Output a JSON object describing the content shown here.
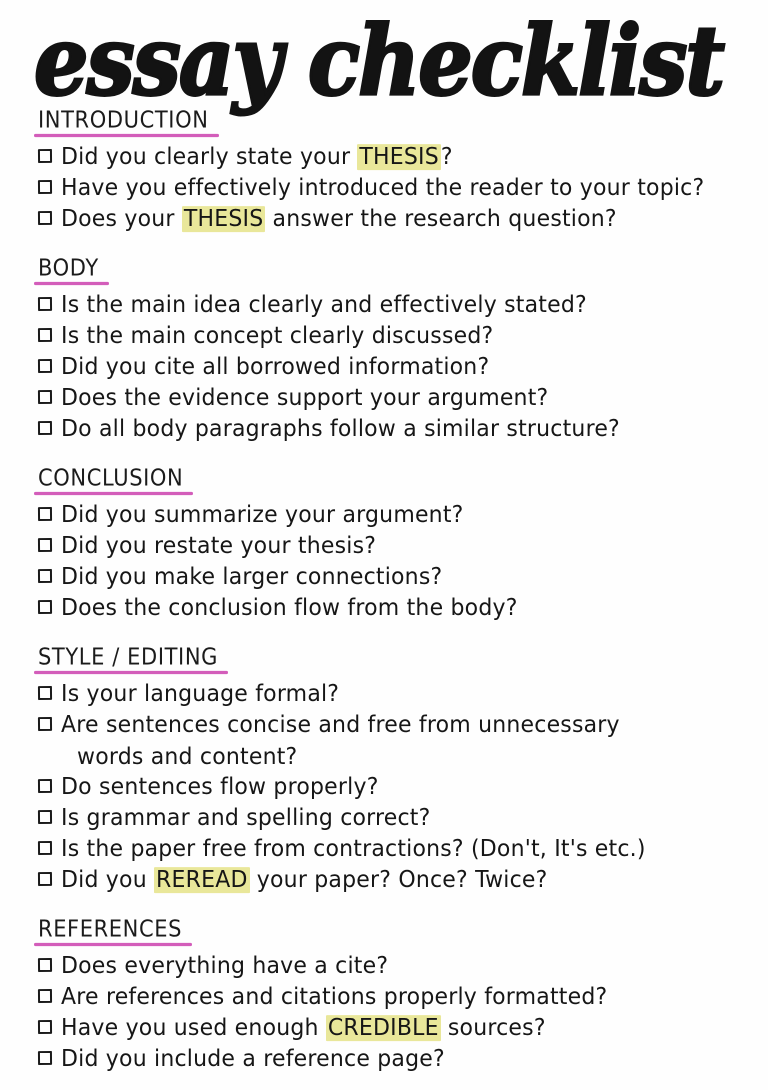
{
  "title": "essay checklist",
  "colors": {
    "ink": "#161616",
    "heading_underline": "#cf4fb4",
    "highlight": "#e9e79a",
    "page_background": "#fefefe"
  },
  "checkbox_glyph": "empty-square",
  "sections": [
    {
      "heading": "INTRODUCTION",
      "items": [
        {
          "pre": "Did you clearly state your ",
          "highlight": "THESIS",
          "post": "?"
        },
        {
          "pre": "Have you effectively introduced the reader to your topic?",
          "highlight": "",
          "post": ""
        },
        {
          "pre": "Does your ",
          "highlight": "THESIS",
          "post": " answer the research question?"
        }
      ]
    },
    {
      "heading": "BODY",
      "items": [
        {
          "pre": "Is the main idea clearly and effectively stated?",
          "highlight": "",
          "post": ""
        },
        {
          "pre": "Is the main concept clearly discussed?",
          "highlight": "",
          "post": ""
        },
        {
          "pre": "Did you cite all borrowed information?",
          "highlight": "",
          "post": ""
        },
        {
          "pre": "Does the evidence support your argument?",
          "highlight": "",
          "post": ""
        },
        {
          "pre": "Do all body paragraphs follow a similar structure?",
          "highlight": "",
          "post": ""
        }
      ]
    },
    {
      "heading": "CONCLUSION",
      "items": [
        {
          "pre": "Did you summarize your argument?",
          "highlight": "",
          "post": ""
        },
        {
          "pre": "Did you restate your thesis?",
          "highlight": "",
          "post": ""
        },
        {
          "pre": "Did you make larger connections?",
          "highlight": "",
          "post": ""
        },
        {
          "pre": "Does the conclusion flow from the body?",
          "highlight": "",
          "post": ""
        }
      ]
    },
    {
      "heading": "STYLE / EDITING",
      "items": [
        {
          "pre": "Is your language formal?",
          "highlight": "",
          "post": ""
        },
        {
          "pre": "Are sentences concise and free from unnecessary",
          "highlight": "",
          "post": "",
          "line2": "words and content?"
        },
        {
          "pre": "Do sentences flow properly?",
          "highlight": "",
          "post": ""
        },
        {
          "pre": "Is grammar and spelling correct?",
          "highlight": "",
          "post": ""
        },
        {
          "pre": "Is the paper free from contractions?  (Don't, It's etc.)",
          "highlight": "",
          "post": ""
        },
        {
          "pre": "Did you ",
          "highlight": "REREAD",
          "post": " your paper? Once? Twice?"
        }
      ]
    },
    {
      "heading": "REFERENCES",
      "items": [
        {
          "pre": "Does everything have a cite?",
          "highlight": "",
          "post": ""
        },
        {
          "pre": "Are references and citations properly formatted?",
          "highlight": "",
          "post": ""
        },
        {
          "pre": "Have you used enough ",
          "highlight": "CREDIBLE",
          "post": " sources?"
        },
        {
          "pre": "Did you include a reference page?",
          "highlight": "",
          "post": ""
        }
      ]
    }
  ]
}
